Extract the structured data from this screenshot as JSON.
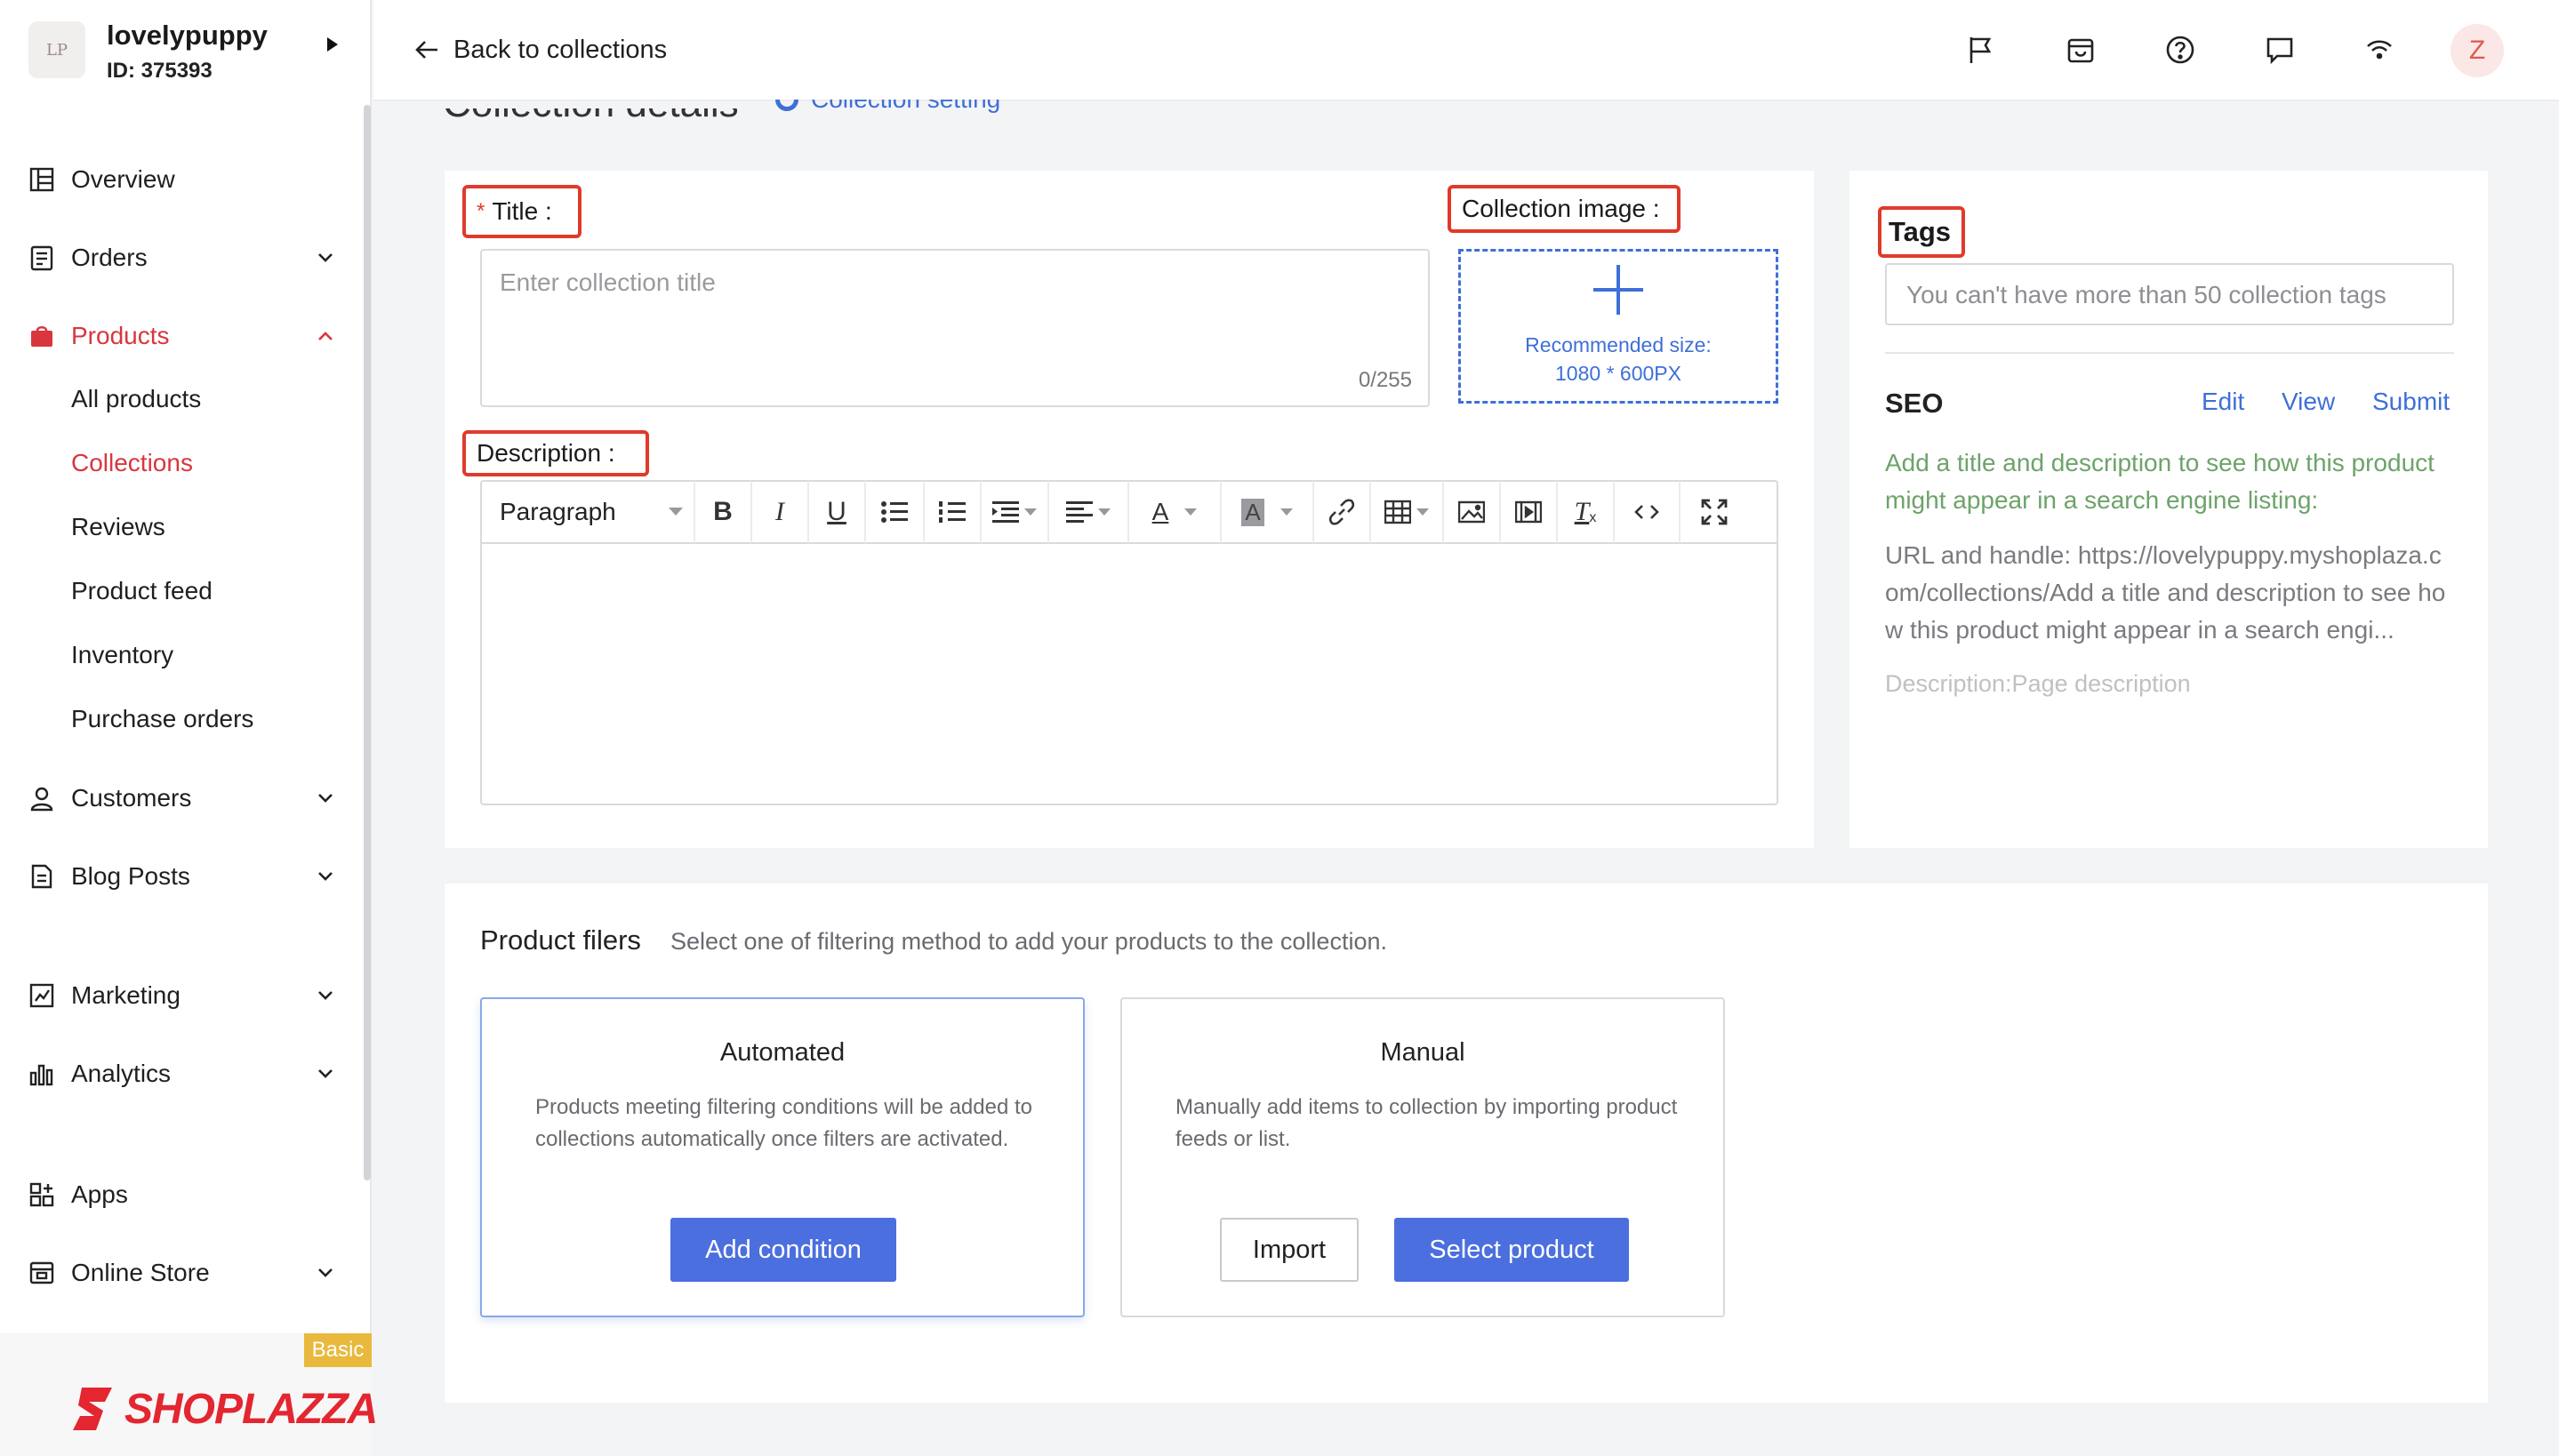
{
  "store": {
    "avatar_text": "LP",
    "name": "lovelypuppy",
    "id": "ID: 375393"
  },
  "sidebar": {
    "items": [
      {
        "label": "Overview",
        "icon": "overview-icon"
      },
      {
        "label": "Orders",
        "icon": "orders-icon"
      },
      {
        "label": "Products",
        "icon": "products-icon"
      },
      {
        "label": "Customers",
        "icon": "customers-icon"
      },
      {
        "label": "Blog Posts",
        "icon": "blog-icon"
      },
      {
        "label": "Marketing",
        "icon": "marketing-icon"
      },
      {
        "label": "Analytics",
        "icon": "analytics-icon"
      },
      {
        "label": "Apps",
        "icon": "apps-icon"
      },
      {
        "label": "Online Store",
        "icon": "store-icon"
      }
    ],
    "products_sub": [
      "All products",
      "Collections",
      "Reviews",
      "Product feed",
      "Inventory",
      "Purchase orders"
    ],
    "active_sub": "Collections"
  },
  "brand": {
    "badge": "Basic",
    "name": "SHOPLAZZA"
  },
  "header": {
    "back_label": "Back to collections",
    "avatar_letter": "Z"
  },
  "page": {
    "heading": "Collection details",
    "setting_link": "Collection setting"
  },
  "form": {
    "required_mark": "*",
    "title_label": "Title :",
    "title_placeholder": "Enter collection title",
    "title_count": "0/255",
    "image_label": "Collection image :",
    "image_note_1": "Recommended size:",
    "image_note_2": "1080 * 600PX",
    "description_label": "Description :",
    "toolbar_paragraph": "Paragraph"
  },
  "seo": {
    "tags_label": "Tags",
    "tags_placeholder": "You can't have more than 50 collection tags",
    "title": "SEO",
    "edit": "Edit",
    "view": "View",
    "submit": "Submit",
    "hint": "Add a title and description to see how this product might appear in a search engine listing:",
    "url": "URL and handle: https://lovelypuppy.myshoplaza.com/collections/Add a title and description to see how this product might appear in a search engi...",
    "description": "Description:Page description"
  },
  "filters": {
    "title": "Product filers",
    "subtitle": "Select one of filtering method to add your products to the collection.",
    "automated": {
      "title": "Automated",
      "desc": "Products meeting filtering conditions will be added to collections automatically once filters are activated.",
      "button": "Add condition"
    },
    "manual": {
      "title": "Manual",
      "desc": "Manually add items to collection by importing product feeds or list.",
      "import": "Import",
      "select": "Select product"
    }
  },
  "colors": {
    "accent": "#4b6fde",
    "active_nav": "#d9363e",
    "highlight": "#e03a2a",
    "seo_hint": "#6da36a"
  }
}
